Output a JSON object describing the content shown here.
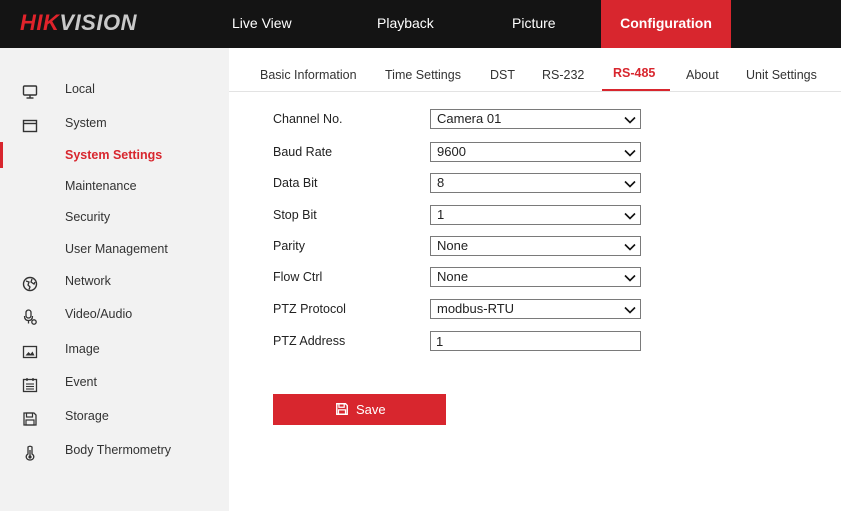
{
  "brand": {
    "part1": "HIK",
    "part2": "VISION",
    "accent": "#d8262e"
  },
  "topnav": {
    "items": [
      {
        "label": "Live View"
      },
      {
        "label": "Playback"
      },
      {
        "label": "Picture"
      },
      {
        "label": "Configuration",
        "active": true
      }
    ]
  },
  "sidebar": {
    "items": [
      {
        "label": "Local",
        "icon": "monitor-icon"
      },
      {
        "label": "System",
        "icon": "window-icon"
      },
      {
        "label": "System Settings",
        "active": true
      },
      {
        "label": "Maintenance"
      },
      {
        "label": "Security"
      },
      {
        "label": "User Management"
      },
      {
        "label": "Network",
        "icon": "globe-icon"
      },
      {
        "label": "Video/Audio",
        "icon": "microphone-icon"
      },
      {
        "label": "Image",
        "icon": "image-icon"
      },
      {
        "label": "Event",
        "icon": "calendar-icon"
      },
      {
        "label": "Storage",
        "icon": "floppy-disk-icon"
      },
      {
        "label": "Body Thermometry",
        "icon": "thermometer-icon"
      }
    ]
  },
  "subtabs": {
    "items": [
      {
        "label": "Basic Information"
      },
      {
        "label": "Time Settings"
      },
      {
        "label": "DST"
      },
      {
        "label": "RS-232"
      },
      {
        "label": "RS-485",
        "active": true
      },
      {
        "label": "About"
      },
      {
        "label": "Unit Settings"
      }
    ]
  },
  "form": {
    "channel": {
      "label": "Channel No.",
      "value": "Camera 01"
    },
    "baud_rate": {
      "label": "Baud Rate",
      "value": "9600"
    },
    "data_bit": {
      "label": "Data Bit",
      "value": "8"
    },
    "stop_bit": {
      "label": "Stop Bit",
      "value": "1"
    },
    "parity": {
      "label": "Parity",
      "value": "None"
    },
    "flow_ctrl": {
      "label": "Flow Ctrl",
      "value": "None"
    },
    "ptz_protocol": {
      "label": "PTZ Protocol",
      "value": "modbus-RTU"
    },
    "ptz_address": {
      "label": "PTZ Address",
      "value": "1"
    }
  },
  "actions": {
    "save_label": "Save"
  }
}
